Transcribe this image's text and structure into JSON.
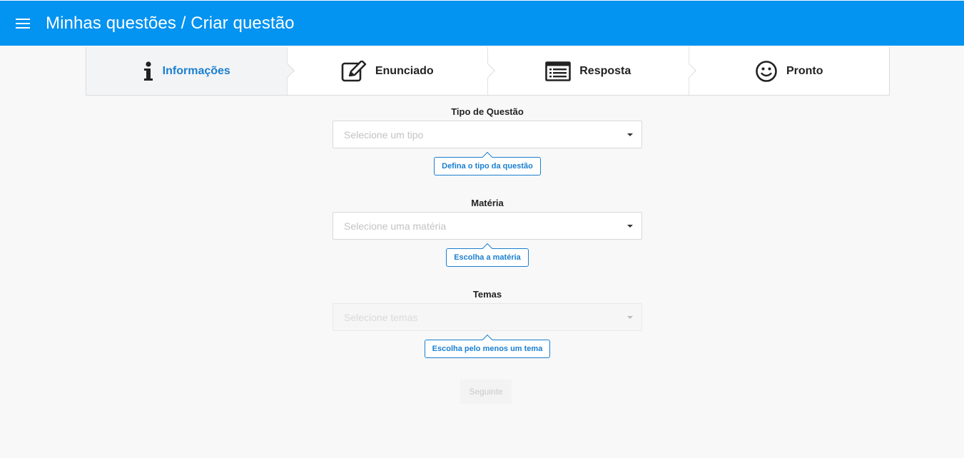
{
  "header": {
    "title": "Minhas questões / Criar questão",
    "bg_color": "#0393f0"
  },
  "steps": [
    {
      "label": "Informações",
      "icon": "info-icon",
      "active": true
    },
    {
      "label": "Enunciado",
      "icon": "edit-icon",
      "active": false
    },
    {
      "label": "Resposta",
      "icon": "list-icon",
      "active": false
    },
    {
      "label": "Pronto",
      "icon": "smiley-icon",
      "active": false
    }
  ],
  "form": {
    "tipo": {
      "label": "Tipo de Questão",
      "placeholder": "Selecione um tipo",
      "hint": "Defina o tipo da questão"
    },
    "materia": {
      "label": "Matéria",
      "placeholder": "Selecione uma matéria",
      "hint": "Escolha a matéria"
    },
    "temas": {
      "label": "Temas",
      "placeholder": "Selecione temas",
      "hint": "Escolha pelo menos um tema",
      "disabled": true
    },
    "next_label": "Seguinte"
  },
  "colors": {
    "accent": "#1a7fcf",
    "active_step_bg": "#f3f4f6"
  }
}
